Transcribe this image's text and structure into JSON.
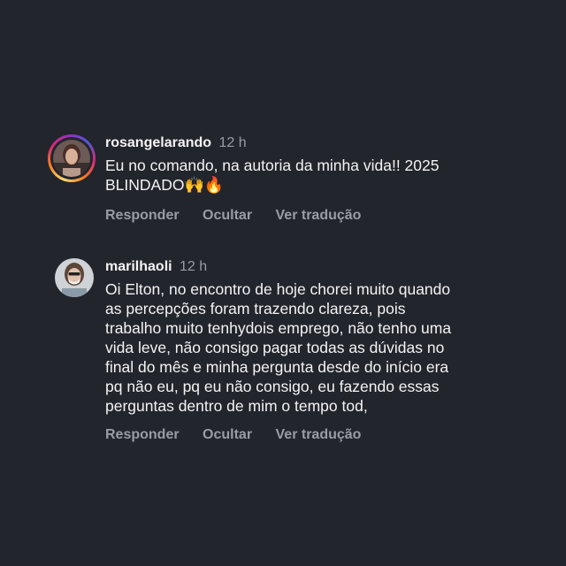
{
  "actions": {
    "reply": "Responder",
    "hide": "Ocultar",
    "translate": "Ver tradução"
  },
  "comments": [
    {
      "username": "rosangelarando",
      "time": "12 h",
      "text_line1": "Eu no comando, na autoria da minha vida!! 2025",
      "text_line2": "BLINDADO",
      "emojis": "🙌🔥",
      "avatar": "avatar-story-ring"
    },
    {
      "username": "marilhaoli",
      "time": "12 h",
      "text": "Oi Elton, no encontro de hoje chorei muito quando\nas percepções foram trazendo clareza, pois\ntrabalho muito tenhydois emprego, não tenho uma\nvida leve, não consigo pagar todas as dúvidas no\nfinal do mês e minha pergunta desde do início era\npq não eu, pq eu não consigo, eu fazendo essas\nperguntas dentro de mim o tempo tod,",
      "avatar": "avatar-plain"
    }
  ],
  "colors": {
    "background": "#23252d",
    "text": "#f3f3f3",
    "muted": "#9a9ca3"
  }
}
